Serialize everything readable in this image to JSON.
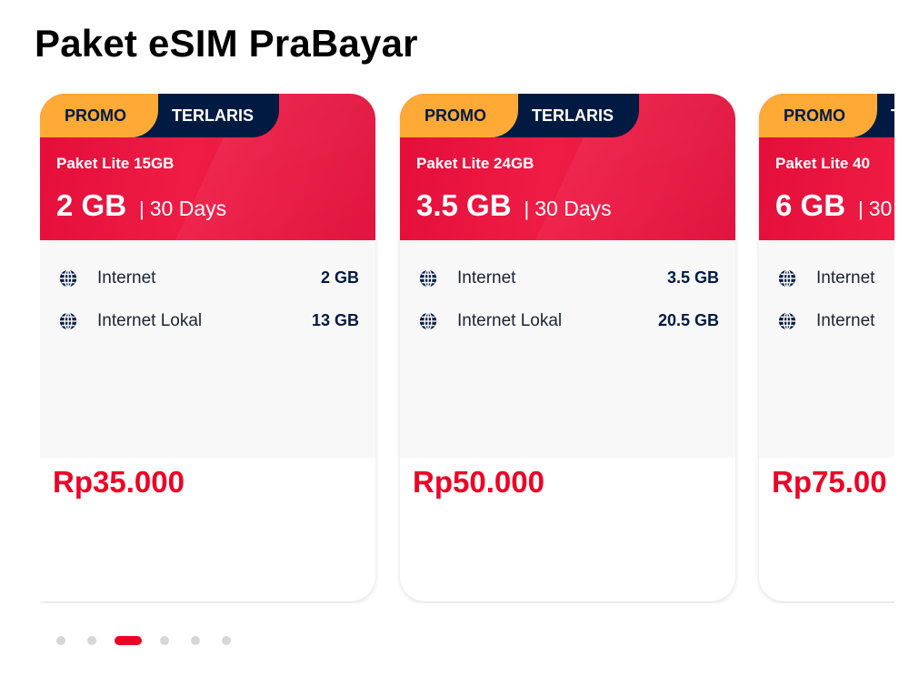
{
  "page": {
    "title": "Paket eSIM PraBayar"
  },
  "colors": {
    "accent_red": "#ed0226",
    "promo_orange": "#ffa937",
    "navy": "#001a41"
  },
  "cards": [
    {
      "badge_promo": "PROMO",
      "badge_terlaris": "TERLARIS",
      "plan_name": "Paket Lite 15GB",
      "quota": "2 GB",
      "separator": "|",
      "duration": "30 Days",
      "benefits": [
        {
          "icon": "globe-icon",
          "label": "Internet",
          "value": "2 GB"
        },
        {
          "icon": "globe-icon",
          "label": "Internet Lokal",
          "value": "13 GB"
        }
      ],
      "price": "Rp35.000"
    },
    {
      "badge_promo": "PROMO",
      "badge_terlaris": "TERLARIS",
      "plan_name": "Paket Lite 24GB",
      "quota": "3.5 GB",
      "separator": "|",
      "duration": "30 Days",
      "benefits": [
        {
          "icon": "globe-icon",
          "label": "Internet",
          "value": "3.5 GB"
        },
        {
          "icon": "globe-icon",
          "label": "Internet Lokal",
          "value": "20.5 GB"
        }
      ],
      "price": "Rp50.000"
    },
    {
      "badge_promo": "PROMO",
      "badge_terlaris": "TERLARIS",
      "plan_name": "Paket Lite 40",
      "quota": "6 GB",
      "separator": "|",
      "duration": "30",
      "benefits": [
        {
          "icon": "globe-icon",
          "label": "Internet",
          "value": ""
        },
        {
          "icon": "globe-icon",
          "label": "Internet",
          "value": ""
        }
      ],
      "price": "Rp75.00"
    }
  ],
  "pagination": {
    "total": 6,
    "active_index": 2
  }
}
